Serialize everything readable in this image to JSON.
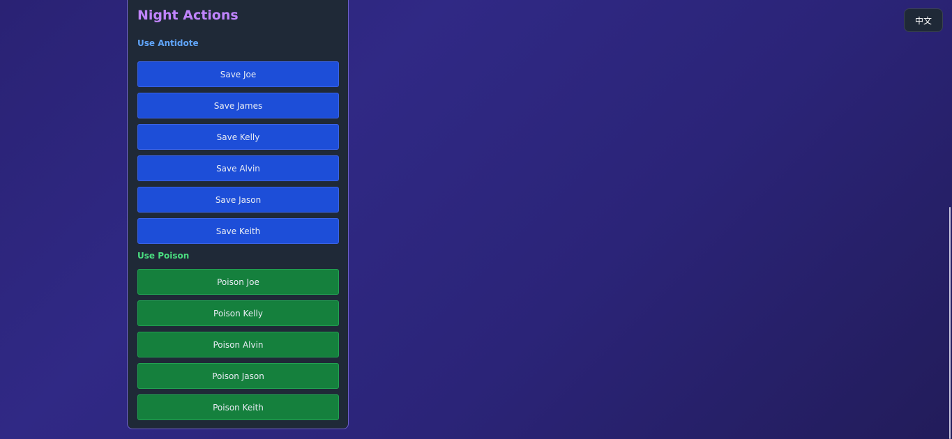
{
  "panel": {
    "title": "Night Actions",
    "antidote": {
      "label": "Use Antidote",
      "buttons": [
        "Save Joe",
        "Save James",
        "Save Kelly",
        "Save Alvin",
        "Save Jason",
        "Save Keith"
      ]
    },
    "poison": {
      "label": "Use Poison",
      "buttons": [
        "Poison Joe",
        "Poison Kelly",
        "Poison Alvin",
        "Poison Jason",
        "Poison Keith"
      ]
    }
  },
  "language_toggle": {
    "label": "中文"
  },
  "colors": {
    "title": "#c084fc",
    "antidote_label": "#60a5fa",
    "poison_label": "#4ade80",
    "save_button": "#1d4ed8",
    "poison_button": "#15803d",
    "panel_bg": "#1f2937"
  }
}
